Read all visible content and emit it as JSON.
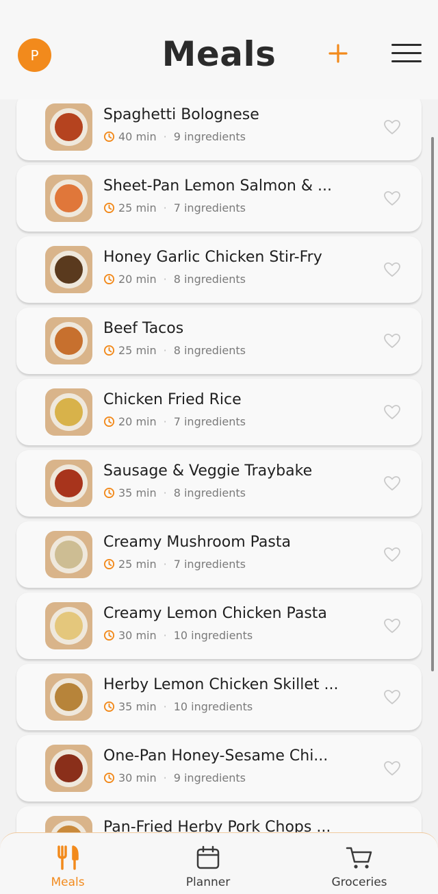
{
  "header": {
    "avatar_initial": "P",
    "title": "Meals"
  },
  "icons": {
    "add": "plus-icon",
    "menu": "hamburger-menu-icon",
    "favorite": "heart-icon",
    "time": "clock-icon"
  },
  "colors": {
    "accent": "#f28a1c",
    "text": "#1f1f1f",
    "muted": "#7a7a7a"
  },
  "meals": [
    {
      "name": "Spaghetti Bolognese",
      "time": "40 min",
      "ingredients": "9 ingredients",
      "food_color": "#b5431f"
    },
    {
      "name": "Sheet-Pan Lemon Salmon & ...",
      "time": "25 min",
      "ingredients": "7 ingredients",
      "food_color": "#e0773a"
    },
    {
      "name": "Honey Garlic Chicken Stir-Fry",
      "time": "20 min",
      "ingredients": "8 ingredients",
      "food_color": "#5a3a1e"
    },
    {
      "name": "Beef Tacos",
      "time": "25 min",
      "ingredients": "8 ingredients",
      "food_color": "#c7702e"
    },
    {
      "name": "Chicken Fried Rice",
      "time": "20 min",
      "ingredients": "7 ingredients",
      "food_color": "#d8b24a"
    },
    {
      "name": "Sausage & Veggie Traybake",
      "time": "35 min",
      "ingredients": "8 ingredients",
      "food_color": "#a8341c"
    },
    {
      "name": "Creamy Mushroom Pasta",
      "time": "25 min",
      "ingredients": "7 ingredients",
      "food_color": "#cdbd93"
    },
    {
      "name": "Creamy Lemon Chicken Pasta",
      "time": "30 min",
      "ingredients": "10 ingredients",
      "food_color": "#e4c77c"
    },
    {
      "name": "Herby Lemon Chicken Skillet ...",
      "time": "35 min",
      "ingredients": "10 ingredients",
      "food_color": "#b7843a"
    },
    {
      "name": "One-Pan Honey-Sesame Chi...",
      "time": "30 min",
      "ingredients": "9 ingredients",
      "food_color": "#8a2f1a"
    },
    {
      "name": "Pan-Fried Herby Pork Chops ...",
      "time": "",
      "ingredients": "",
      "food_color": "#c98a3c"
    }
  ],
  "nav": {
    "items": [
      {
        "label": "Meals",
        "icon": "fork-knife-icon",
        "active": true
      },
      {
        "label": "Planner",
        "icon": "calendar-icon",
        "active": false
      },
      {
        "label": "Groceries",
        "icon": "cart-icon",
        "active": false
      }
    ]
  }
}
